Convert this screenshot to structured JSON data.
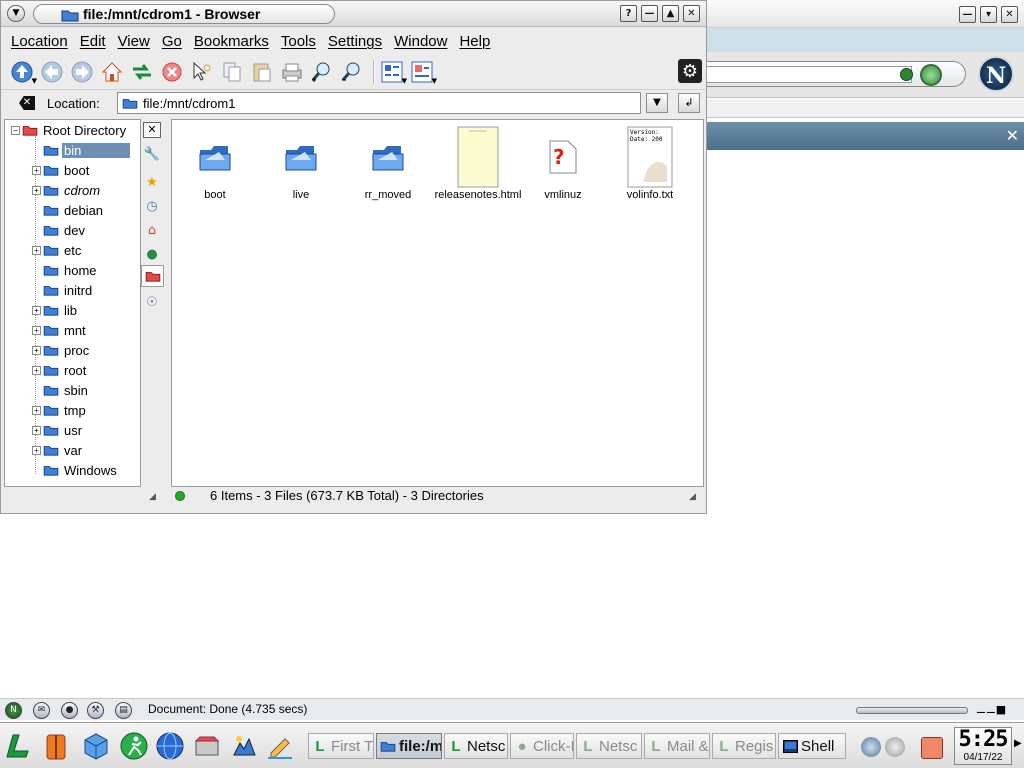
{
  "window": {
    "title": "file:/mnt/cdrom1 - Browser"
  },
  "menu": [
    "Location",
    "Edit",
    "View",
    "Go",
    "Bookmarks",
    "Tools",
    "Settings",
    "Window",
    "Help"
  ],
  "location": {
    "label": "Location:",
    "value": "file:/mnt/cdrom1"
  },
  "tree": {
    "root": "Root Directory",
    "items": [
      "bin",
      "boot",
      "cdrom",
      "debian",
      "dev",
      "etc",
      "home",
      "initrd",
      "lib",
      "mnt",
      "proc",
      "root",
      "sbin",
      "tmp",
      "usr",
      "var",
      "Windows"
    ],
    "selected": "bin"
  },
  "files": [
    {
      "name": "boot",
      "icon": "folder-icon"
    },
    {
      "name": "live",
      "icon": "folder-icon"
    },
    {
      "name": "rr_moved",
      "icon": "folder-icon"
    },
    {
      "name": "releasenotes.html",
      "icon": "html-document-icon"
    },
    {
      "name": "vmlinuz",
      "icon": "unknown-file-icon"
    },
    {
      "name": "volinfo.txt",
      "icon": "text-document-icon",
      "preview": [
        "Version:",
        "Date: 200"
      ]
    }
  ],
  "status": {
    "text": "6 Items - 3 Files (673.7 KB Total) - 3 Directories"
  },
  "netscape": {
    "status": "Document: Done (4.735 secs)"
  },
  "taskbar": {
    "tasks": [
      {
        "label": "First Ti",
        "active": false
      },
      {
        "label": "file:/m",
        "active": true
      },
      {
        "label": "Netsc",
        "active": false,
        "bright": true
      },
      {
        "label": "Click-I",
        "active": false
      },
      {
        "label": "Netsc",
        "active": false
      },
      {
        "label": "Mail &",
        "active": false
      },
      {
        "label": "Regis",
        "active": false
      },
      {
        "label": "Shell",
        "active": false,
        "bright": true
      }
    ],
    "clock": {
      "time": "5:25",
      "date": "04/17/22"
    }
  },
  "colors": {
    "selection": "#6e8fb3",
    "folder": "#3f7fd4",
    "sidebar_tab": "#5a7b95"
  }
}
